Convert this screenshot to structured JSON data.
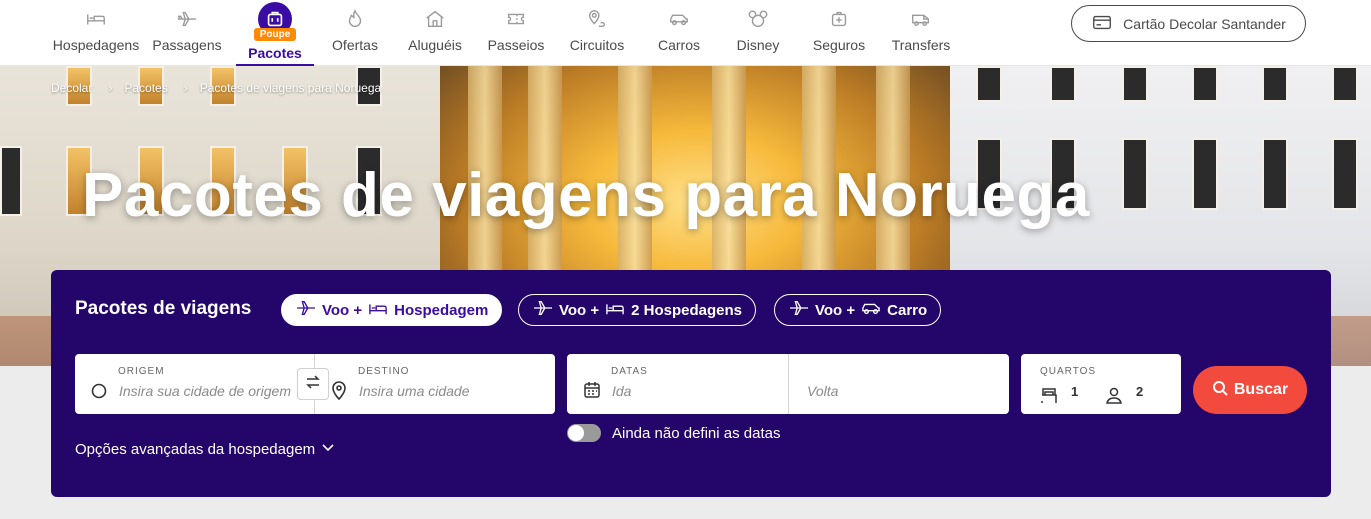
{
  "nav": {
    "items": [
      {
        "label": "Hospedagens",
        "icon": "bed-icon"
      },
      {
        "label": "Passagens",
        "icon": "plane-icon"
      },
      {
        "label": "Pacotes",
        "icon": "suitcase-icon",
        "badge": "Poupe",
        "active": true
      },
      {
        "label": "Ofertas",
        "icon": "flame-icon"
      },
      {
        "label": "Aluguéis",
        "icon": "house-icon"
      },
      {
        "label": "Passeios",
        "icon": "ticket-icon"
      },
      {
        "label": "Circuitos",
        "icon": "route-pin-icon"
      },
      {
        "label": "Carros",
        "icon": "car-icon"
      },
      {
        "label": "Disney",
        "icon": "mouse-ears-icon"
      },
      {
        "label": "Seguros",
        "icon": "medical-kit-icon"
      },
      {
        "label": "Transfers",
        "icon": "van-icon"
      }
    ],
    "card_button": "Cartão Decolar Santander"
  },
  "breadcrumb": [
    "Decolar",
    "Pacotes",
    "Pacotes de viagens para Noruega"
  ],
  "hero": {
    "title": "Pacotes de viagens para Noruega"
  },
  "search": {
    "title": "Pacotes de viagens",
    "options": [
      {
        "prefix": "Voo +",
        "label": "Hospedagem",
        "active": true
      },
      {
        "prefix": "Voo +",
        "label": "2 Hospedagens",
        "active": false
      },
      {
        "prefix": "Voo +",
        "label": "Carro",
        "active": false
      }
    ],
    "origin": {
      "label": "ORIGEM",
      "placeholder": "Insira sua cidade de origem"
    },
    "destination": {
      "label": "DESTINO",
      "placeholder": "Insira uma cidade"
    },
    "dates": {
      "label": "DATAS",
      "depart_placeholder": "Ida",
      "return_placeholder": "Volta"
    },
    "rooms": {
      "label": "QUARTOS",
      "rooms_count": "1",
      "people_count": "2"
    },
    "search_button": "Buscar",
    "no_dates_toggle": "Ainda não defini as datas",
    "advanced_options": "Opções avançadas da hospedagem"
  },
  "colors": {
    "brand_purple": "#3a0ca3",
    "panel_bg": "#240569",
    "search_button": "#f24a3c",
    "badge_orange": "#ff8a00"
  }
}
